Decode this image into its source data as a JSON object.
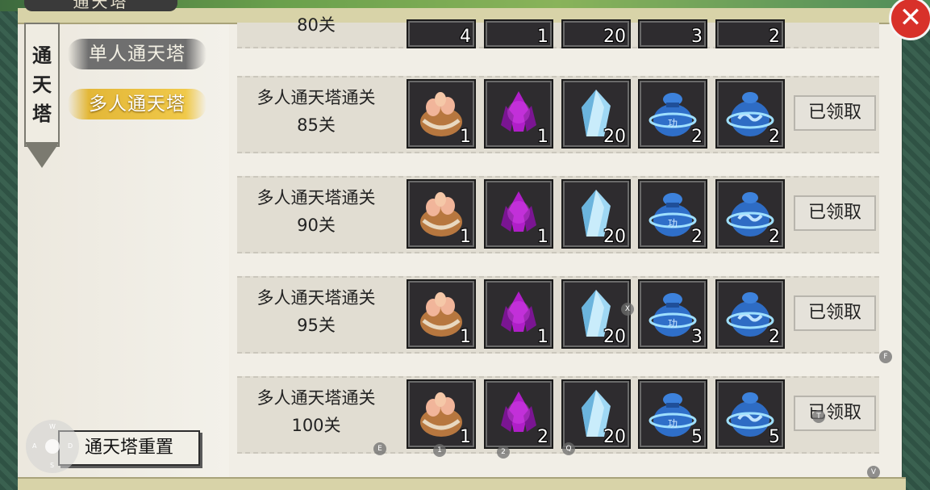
{
  "window": {
    "top_title": "通天塔",
    "close_glyph": "✕"
  },
  "banner": {
    "chars": [
      "通",
      "天",
      "塔"
    ]
  },
  "tabs": [
    {
      "label": "单人通天塔",
      "active": false
    },
    {
      "label": "多人通天塔",
      "active": true
    }
  ],
  "reset_button": "通天塔重置",
  "partial_row": {
    "label": "80关",
    "counts": [
      "4",
      "1",
      "20",
      "3",
      "2"
    ]
  },
  "rows": [
    {
      "title": "多人通天塔通关",
      "level": "85关",
      "items": [
        {
          "icon": "cake-bag-icon",
          "count": "1"
        },
        {
          "icon": "purple-crystal-icon",
          "count": "1"
        },
        {
          "icon": "ice-crystal-icon",
          "count": "20"
        },
        {
          "icon": "blue-pouch-icon",
          "count": "2"
        },
        {
          "icon": "blue-swirl-pouch-icon",
          "count": "2"
        }
      ],
      "status": "已领取"
    },
    {
      "title": "多人通天塔通关",
      "level": "90关",
      "items": [
        {
          "icon": "cake-bag-icon",
          "count": "1"
        },
        {
          "icon": "purple-crystal-icon",
          "count": "1"
        },
        {
          "icon": "ice-crystal-icon",
          "count": "20"
        },
        {
          "icon": "blue-pouch-icon",
          "count": "2"
        },
        {
          "icon": "blue-swirl-pouch-icon",
          "count": "2"
        }
      ],
      "status": "已领取"
    },
    {
      "title": "多人通天塔通关",
      "level": "95关",
      "items": [
        {
          "icon": "cake-bag-icon",
          "count": "1"
        },
        {
          "icon": "purple-crystal-icon",
          "count": "1"
        },
        {
          "icon": "ice-crystal-icon",
          "count": "20"
        },
        {
          "icon": "blue-pouch-icon",
          "count": "3"
        },
        {
          "icon": "blue-swirl-pouch-icon",
          "count": "2"
        }
      ],
      "status": "已领取"
    },
    {
      "title": "多人通天塔通关",
      "level": "100关",
      "items": [
        {
          "icon": "cake-bag-icon",
          "count": "1"
        },
        {
          "icon": "purple-crystal-icon",
          "count": "2"
        },
        {
          "icon": "ice-crystal-icon",
          "count": "20"
        },
        {
          "icon": "blue-pouch-icon",
          "count": "5"
        },
        {
          "icon": "blue-swirl-pouch-icon",
          "count": "5"
        }
      ],
      "status": "已领取"
    }
  ],
  "joystick": {
    "keys": [
      "W",
      "A",
      "S",
      "D"
    ]
  },
  "hotkeys": [
    "E",
    "1",
    "2",
    "Q",
    "X",
    "F",
    "T",
    "V"
  ]
}
